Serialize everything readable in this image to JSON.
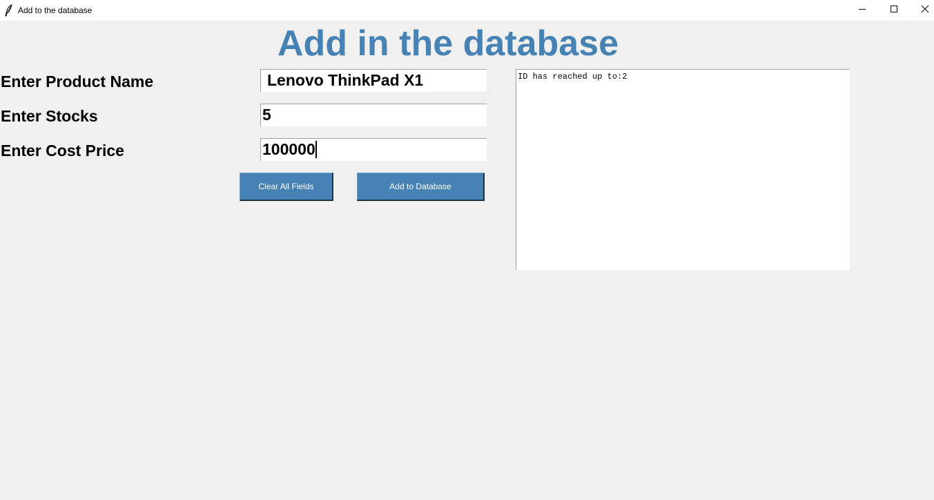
{
  "window": {
    "title": "Add to the database"
  },
  "heading": "Add in the database",
  "form": {
    "product_name_label": "Enter Product Name",
    "stocks_label": "Enter Stocks",
    "cost_price_label": "Enter Cost Price",
    "product_name_value": "Lenovo ThinkPad X1",
    "stocks_value": "5",
    "cost_price_value": "100000"
  },
  "buttons": {
    "clear_label": "Clear All Fields",
    "add_label": "Add to Database"
  },
  "output": {
    "text": "ID has reached up to:2"
  },
  "colors": {
    "accent": "#4682b4",
    "background": "#f0f0f0"
  },
  "icons": {
    "app": "feather-icon",
    "minimize": "minimize-icon",
    "maximize": "maximize-icon",
    "close": "close-icon"
  }
}
